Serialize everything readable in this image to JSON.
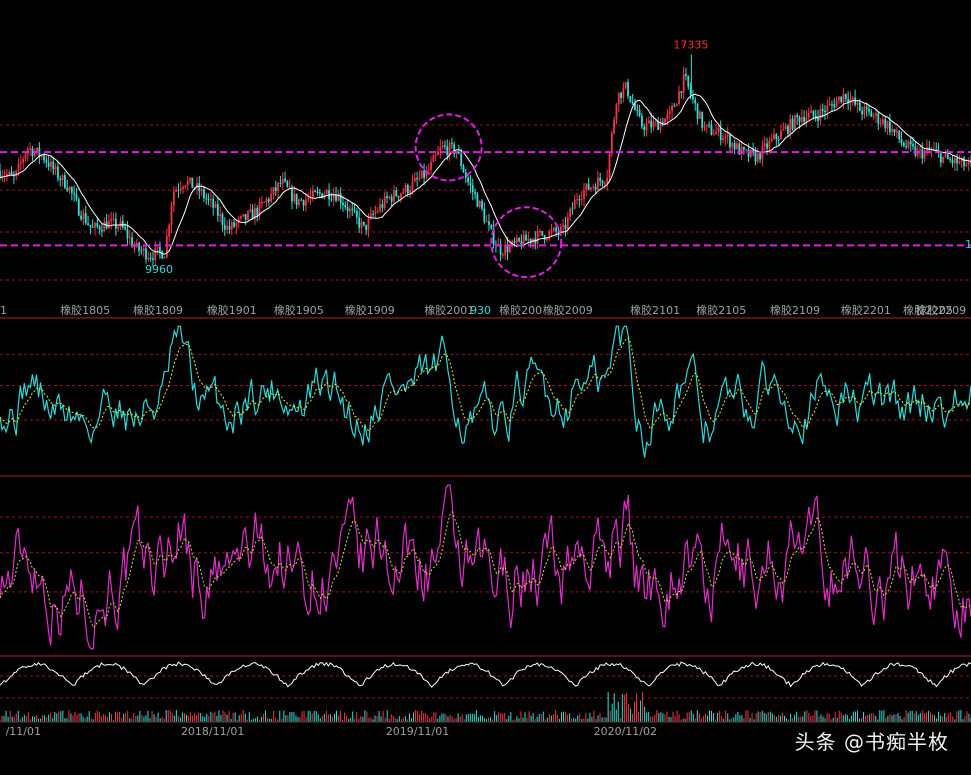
{
  "colors": {
    "background": "#000000",
    "grid": "#8b1a1a",
    "separator": "#b22222",
    "up_candle": "#f23645",
    "down_candle": "#32e0d6",
    "ma_main": "#ffffff",
    "support_line": "#e020e0",
    "osc1_line": "#30d8d8",
    "osc1_signal": "#e8e830",
    "osc2_line": "#e030c8",
    "osc2_signal": "#c8e030",
    "high_label": "#ff3030",
    "low_label": "#30d8d8",
    "contract_label": "#a0a0a0",
    "date_label": "#a0a0a0",
    "circle_annotation": "#e020e0"
  },
  "chart_data": [
    {
      "type": "candlestick",
      "panel": "price",
      "annotations": {
        "high_value": "17335",
        "low_value": "9960",
        "low2_value": "930",
        "right_edge_value": "1"
      },
      "contract_labels": [
        "1",
        "橡胶1805",
        "橡胶1809",
        "橡胶1901",
        "橡胶1905",
        "橡胶1909",
        "橡胶2001",
        "橡胶200",
        "橡胶2009",
        "橡胶2101",
        "橡胶2105",
        "橡胶2109",
        "橡胶2201",
        "橡胶2205",
        "橡胶2209"
      ],
      "contract_positions": [
        0,
        0.062,
        0.137,
        0.213,
        0.282,
        0.355,
        0.437,
        0.514,
        0.559,
        0.649,
        0.717,
        0.793,
        0.866,
        0.93,
        0.995
      ],
      "support_levels": [
        11300,
        14250
      ],
      "y_range": [
        9000,
        17800
      ],
      "price_path": [
        [
          0.0,
          13650
        ],
        [
          0.015,
          13400
        ],
        [
          0.028,
          14400
        ],
        [
          0.045,
          14100
        ],
        [
          0.06,
          13500
        ],
        [
          0.07,
          13200
        ],
        [
          0.08,
          12500
        ],
        [
          0.095,
          11800
        ],
        [
          0.11,
          12000
        ],
        [
          0.125,
          11900
        ],
        [
          0.14,
          11200
        ],
        [
          0.155,
          11000
        ],
        [
          0.17,
          11100
        ],
        [
          0.178,
          13000
        ],
        [
          0.19,
          13350
        ],
        [
          0.205,
          13050
        ],
        [
          0.22,
          12500
        ],
        [
          0.235,
          11800
        ],
        [
          0.25,
          12100
        ],
        [
          0.265,
          12400
        ],
        [
          0.28,
          12900
        ],
        [
          0.29,
          13300
        ],
        [
          0.305,
          12700
        ],
        [
          0.32,
          12800
        ],
        [
          0.335,
          13000
        ],
        [
          0.348,
          12900
        ],
        [
          0.36,
          12400
        ],
        [
          0.375,
          11800
        ],
        [
          0.385,
          12300
        ],
        [
          0.4,
          12800
        ],
        [
          0.42,
          13100
        ],
        [
          0.44,
          13600
        ],
        [
          0.455,
          14400
        ],
        [
          0.47,
          14300
        ],
        [
          0.482,
          13300
        ],
        [
          0.495,
          12500
        ],
        [
          0.505,
          11700
        ],
        [
          0.515,
          11150
        ],
        [
          0.53,
          11300
        ],
        [
          0.545,
          11500
        ],
        [
          0.56,
          11650
        ],
        [
          0.58,
          11750
        ],
        [
          0.595,
          12900
        ],
        [
          0.61,
          13200
        ],
        [
          0.625,
          13500
        ],
        [
          0.635,
          16000
        ],
        [
          0.645,
          16300
        ],
        [
          0.66,
          15100
        ],
        [
          0.675,
          15100
        ],
        [
          0.69,
          15400
        ],
        [
          0.705,
          16600
        ],
        [
          0.712,
          16000
        ],
        [
          0.725,
          15000
        ],
        [
          0.745,
          14800
        ],
        [
          0.765,
          14200
        ],
        [
          0.78,
          14100
        ],
        [
          0.795,
          14600
        ],
        [
          0.81,
          15000
        ],
        [
          0.825,
          15400
        ],
        [
          0.84,
          15400
        ],
        [
          0.855,
          15700
        ],
        [
          0.87,
          16100
        ],
        [
          0.885,
          15600
        ],
        [
          0.9,
          15400
        ],
        [
          0.915,
          15100
        ],
        [
          0.93,
          14500
        ],
        [
          0.945,
          14200
        ],
        [
          0.96,
          14300
        ],
        [
          0.975,
          14000
        ],
        [
          1.0,
          13800
        ]
      ],
      "spike_high_x": 0.712,
      "low_x": 0.17,
      "low2_x": 0.515,
      "circles": [
        {
          "x": 0.462,
          "y": 14400,
          "r": 0.034
        },
        {
          "x": 0.542,
          "y": 11400,
          "r": 0.036
        }
      ]
    },
    {
      "type": "line",
      "panel": "oscillator_1",
      "series": [
        {
          "role": "main"
        },
        {
          "role": "signal"
        }
      ],
      "y_range": [
        -1,
        1
      ]
    },
    {
      "type": "line",
      "panel": "oscillator_2",
      "series": [
        {
          "role": "main"
        },
        {
          "role": "signal"
        }
      ],
      "y_range": [
        -1,
        1
      ]
    },
    {
      "type": "area",
      "panel": "volume",
      "x_tick_labels": [
        "/11/01",
        "2018/11/01",
        "2019/11/01",
        "2020/11/02"
      ],
      "x_tick_positions": [
        0.024,
        0.219,
        0.43,
        0.644
      ]
    }
  ],
  "watermark": {
    "text": "头条 @书痴半枚"
  }
}
